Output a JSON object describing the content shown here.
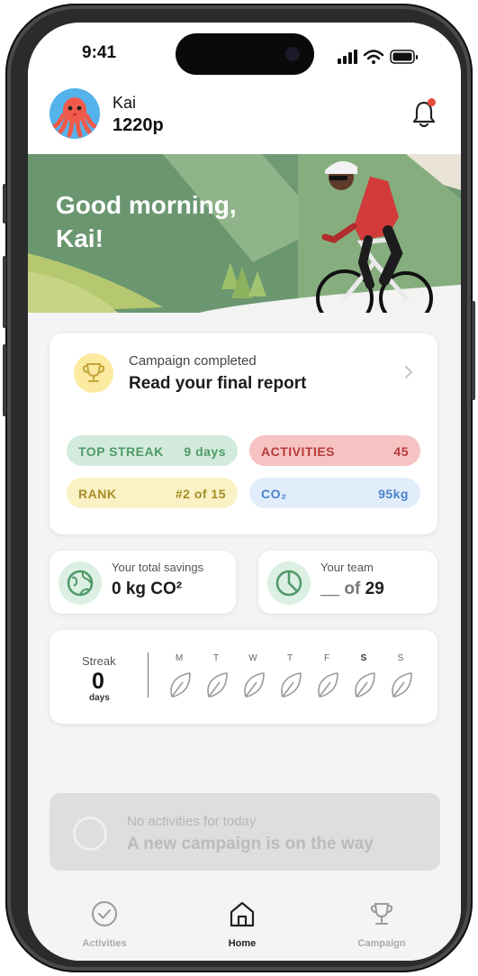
{
  "status_bar": {
    "time": "9:41"
  },
  "user": {
    "name": "Kai",
    "points": "1220p"
  },
  "hero": {
    "greeting": "Good morning,\nKai!"
  },
  "campaign": {
    "subtitle": "Campaign completed",
    "title": "Read your final report",
    "stats": [
      {
        "label": "TOP STREAK",
        "value": "9 days",
        "color": "#4e9a68"
      },
      {
        "label": "ACTIVITIES",
        "value": "45",
        "color": "#b83a3a"
      },
      {
        "label": "RANK",
        "value": "#2 of 15",
        "color": "#a58d27"
      },
      {
        "label": "CO₂",
        "value": "95kg",
        "color": "#4a82c9"
      }
    ]
  },
  "savings": {
    "label": "Your total savings",
    "value": "0 kg CO²"
  },
  "team": {
    "label": "Your team",
    "value_prefix": "__",
    "value_suffix": " of ",
    "value_total": "29"
  },
  "streak": {
    "label": "Streak",
    "value": "0",
    "unit": "days",
    "days": [
      "M",
      "T",
      "W",
      "T",
      "F",
      "S",
      "S"
    ]
  },
  "empty_state": {
    "subtitle": "No activities for today",
    "title": "A new campaign is on the way"
  },
  "tabs": [
    {
      "label": "Activities",
      "icon": "check-circle-icon",
      "active": false
    },
    {
      "label": "Home",
      "icon": "house-icon",
      "active": true
    },
    {
      "label": "Campaign",
      "icon": "trophy-icon",
      "active": false
    }
  ],
  "colors": {
    "accent_green": "#4e9a68",
    "notification": "#e84b3c"
  }
}
